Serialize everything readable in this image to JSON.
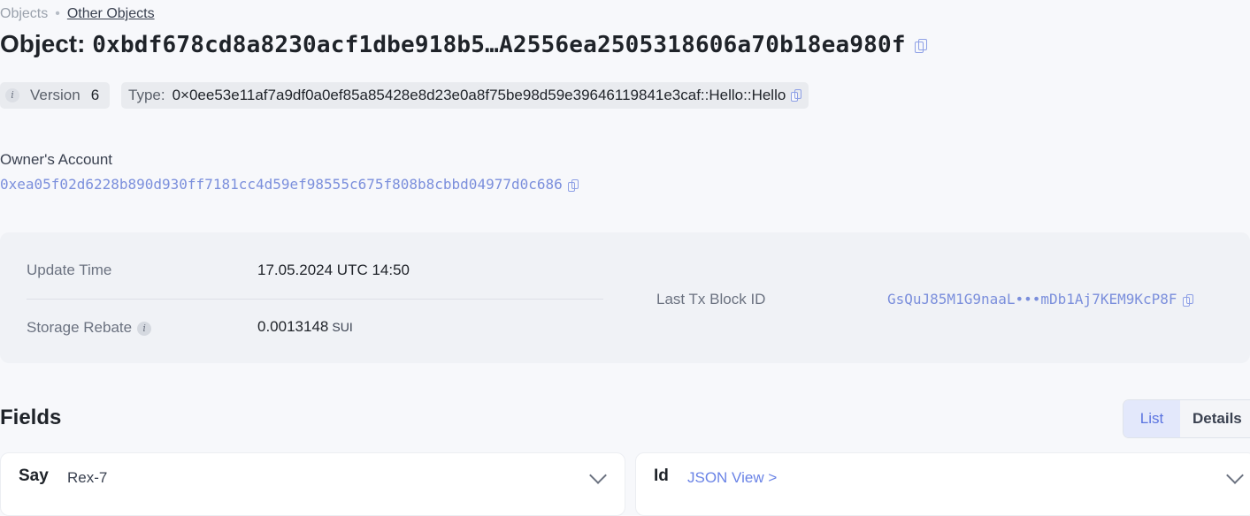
{
  "breadcrumb": {
    "root": "Objects",
    "separator": "•",
    "current": "Other Objects"
  },
  "object": {
    "title_label": "Object:",
    "address": "0xbdf678cd8a8230acf1dbe918b5…A2556ea2505318606a70b18ea980f"
  },
  "version": {
    "info_icon": "i",
    "label": "Version",
    "value": "6"
  },
  "type": {
    "label": "Type:",
    "value": "0×0ee53e11af7a9df0a0ef85a85428e8d23e0a8f75be98d59e39646119841e3caf::Hello::Hello"
  },
  "owner": {
    "label": "Owner's Account",
    "address": "0xea05f02d6228b890d930ff7181cc4d59ef98555c675f808b8cbbd04977d0c686"
  },
  "details": {
    "update_time_label": "Update Time",
    "update_time_value": "17.05.2024 UTC 14:50",
    "storage_rebate_label": "Storage Rebate",
    "storage_rebate_value": "0.0013148",
    "storage_rebate_unit": "SUI",
    "info_icon": "i",
    "last_tx_label": "Last Tx Block ID",
    "last_tx_value": "GsQuJ85M1G9naaL•••mDb1Aj7KEM9KcP8F"
  },
  "fields": {
    "title": "Fields",
    "view_toggle": {
      "list": "List",
      "details": "Details",
      "selected": "List"
    },
    "items": [
      {
        "name": "Say",
        "value": "Rex-7"
      },
      {
        "name": "Id",
        "value": "JSON View >"
      }
    ]
  },
  "colors": {
    "accent": "#6a83e6",
    "link": "#7b8fdc",
    "background": "#f7f8fb"
  },
  "icons": [
    "copy-icon",
    "info-icon",
    "chevron-down-icon"
  ]
}
